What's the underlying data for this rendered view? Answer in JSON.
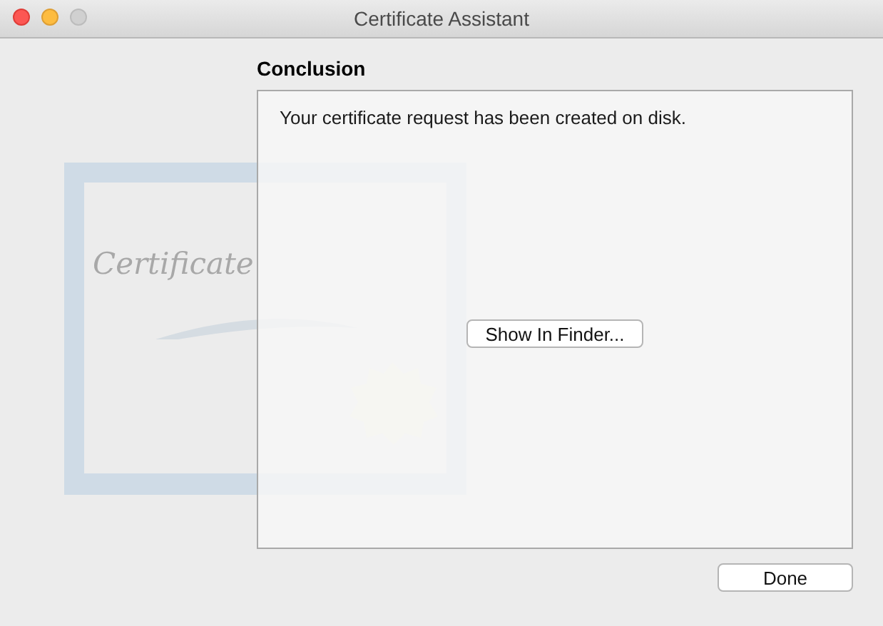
{
  "window": {
    "title": "Certificate Assistant"
  },
  "artwork": {
    "text": "Certificate"
  },
  "heading": "Conclusion",
  "message": "Your certificate request has been created on disk.",
  "finder_button": "Show In Finder...",
  "buttons": [
    "Done"
  ]
}
